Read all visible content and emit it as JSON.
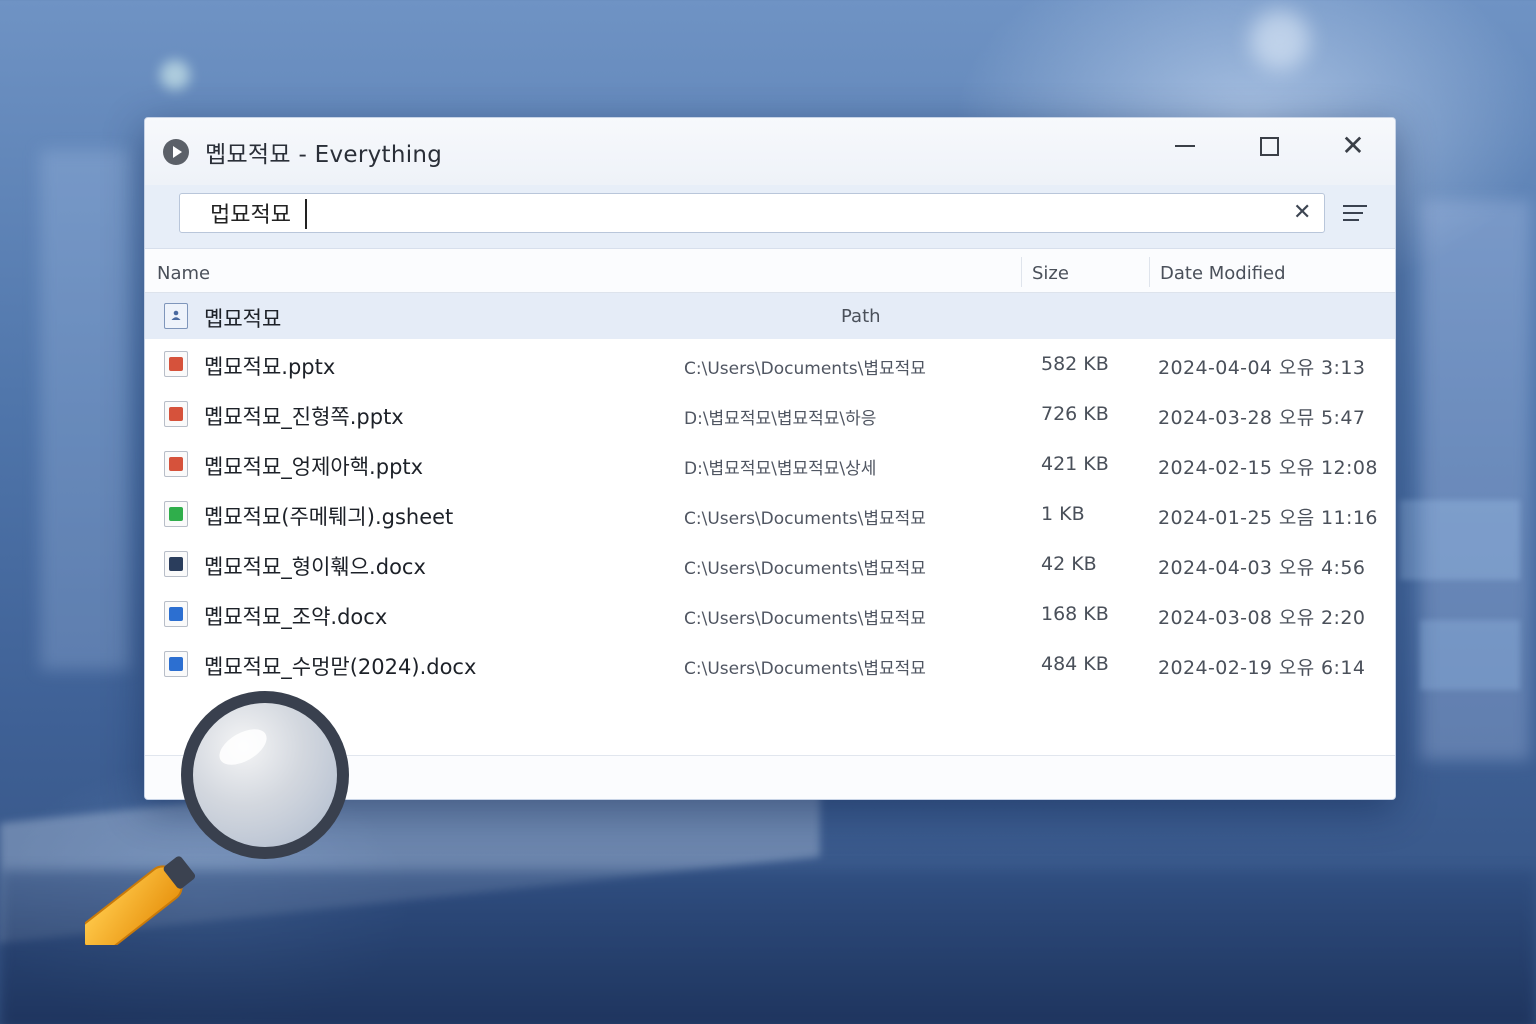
{
  "window": {
    "title": "몝묘적묘 - Everything"
  },
  "search": {
    "query": "멉묘적묘"
  },
  "columns": {
    "name": "Name",
    "size": "Size",
    "date": "Date Modified",
    "path": "Path"
  },
  "folder_row": {
    "name": "몝묘적묘"
  },
  "files": [
    {
      "name": "몝묘적묘.pptx",
      "path": "C:\\Users\\Documents\\볍묘적묘",
      "size": "582 KB",
      "date": "2024-04-04 오유 3:13",
      "type": "ppt"
    },
    {
      "name": "몝묘적묘_진형쪽.pptx",
      "path": "D:\\볍묘적묘\\볍묘적묘\\하응",
      "size": "726 KB",
      "date": "2024-03-28 오뮤 5:47",
      "type": "ppt"
    },
    {
      "name": "몝묘적묘_엉제아핵.pptx",
      "path": "D:\\볍묘적묘\\볍묘적묘\\상세",
      "size": "421 KB",
      "date": "2024-02-15 오유 12:08",
      "type": "ppt"
    },
    {
      "name": "몝묘적묘(주메퉤긔).gsheet",
      "path": "C:\\Users\\Documents\\볍묘적묘",
      "size": "1 KB",
      "date": "2024-01-25 오음 11:16",
      "type": "sheet"
    },
    {
      "name": "몝묘적묘_형이훾으.docx",
      "path": "C:\\Users\\Documents\\볍묘적묘",
      "size": "42 KB",
      "date": "2024-04-03 오유 4:56",
      "type": "doc-dark"
    },
    {
      "name": "몝묘적묘_조약.docx",
      "path": "C:\\Users\\Documents\\볍묘적묘",
      "size": "168 KB",
      "date": "2024-03-08 오유 2:20",
      "type": "doc"
    },
    {
      "name": "몝묘적묘_수멍맏(2024).docx",
      "path": "C:\\Users\\Documents\\볍묘적묘",
      "size": "484 KB",
      "date": "2024-02-19 오유 6:14",
      "type": "doc"
    }
  ],
  "colors": {
    "accent": "#2c6fd1",
    "ppt": "#d6523b",
    "sheet": "#2fae4b",
    "selected_row": "#e5ecf7",
    "magnifier_handle": "#f0a623"
  },
  "icons": {
    "app": "everything-play-icon",
    "clear": "close-x-icon",
    "menu": "hamburger-menu-icon",
    "folder": "folder-user-icon"
  }
}
